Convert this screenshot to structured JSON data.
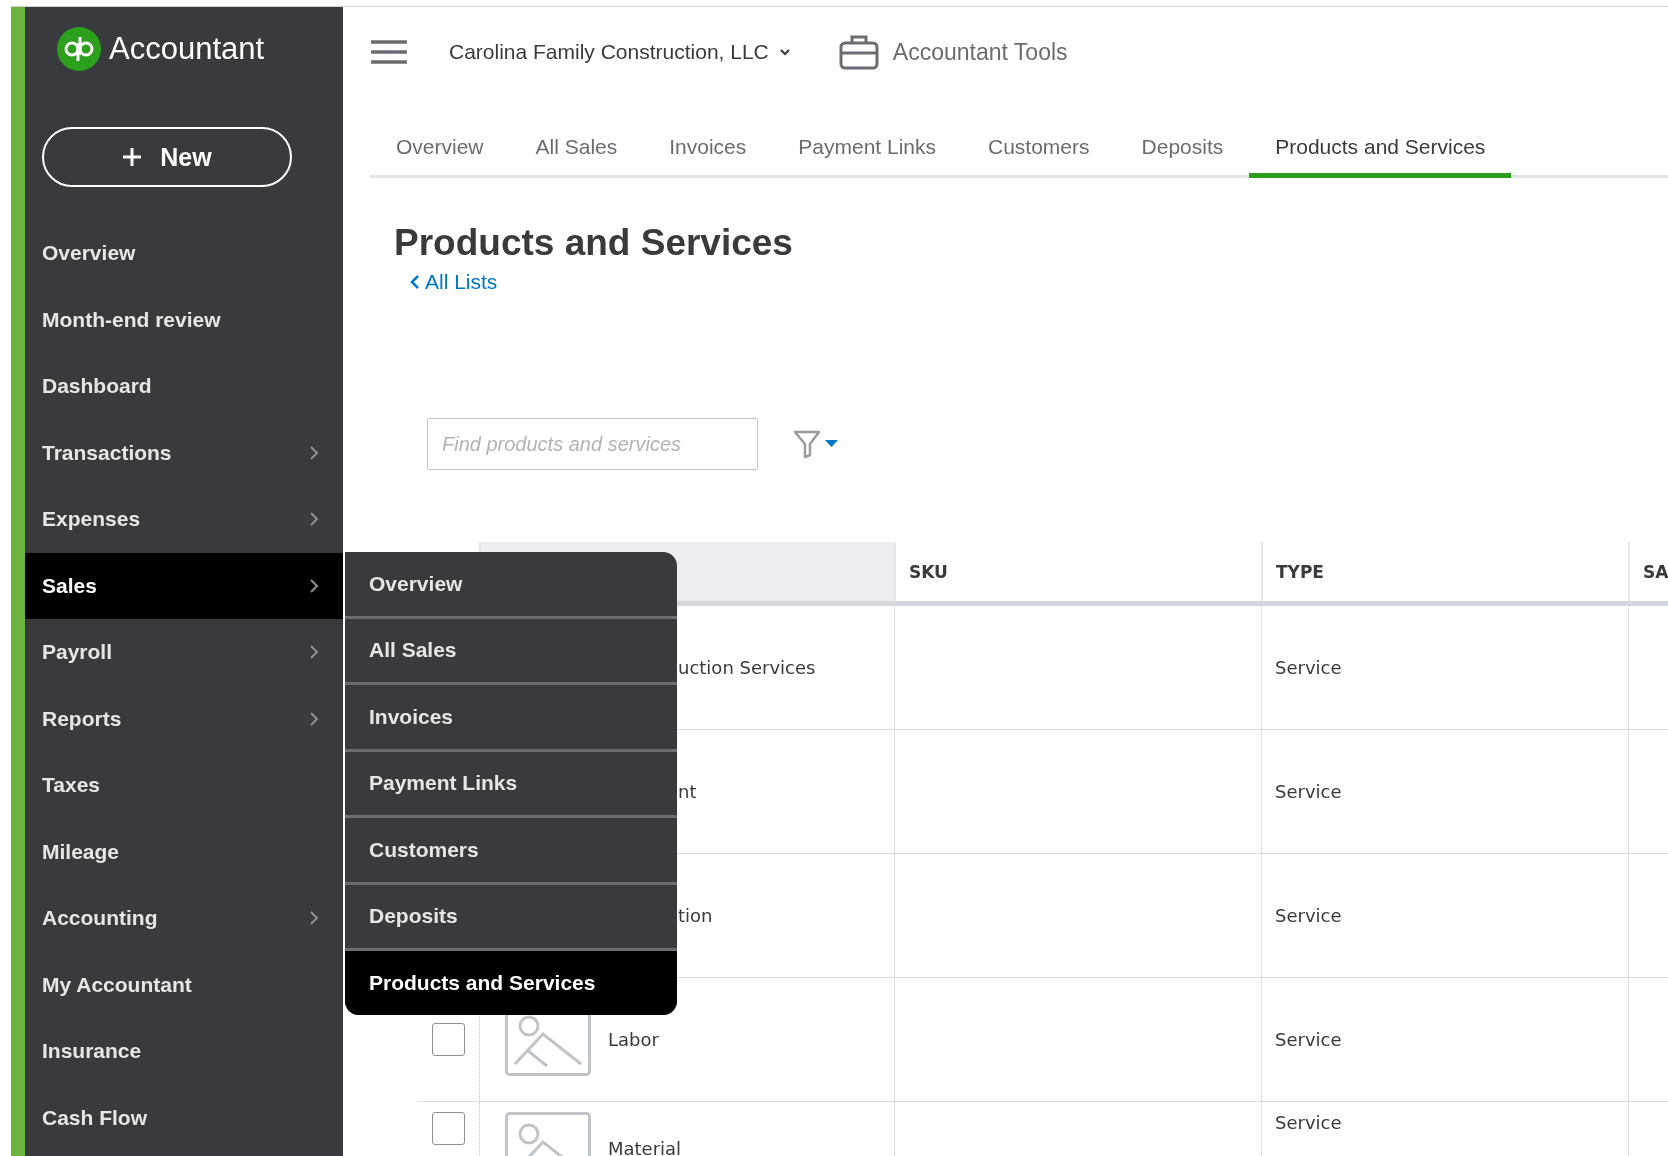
{
  "sidebar": {
    "logo_text": "Accountant",
    "new_button": "New",
    "items": [
      {
        "label": "Overview",
        "has_submenu": false,
        "selected": false
      },
      {
        "label": "Month-end review",
        "has_submenu": false,
        "selected": false
      },
      {
        "label": "Dashboard",
        "has_submenu": false,
        "selected": false
      },
      {
        "label": "Transactions",
        "has_submenu": true,
        "selected": false
      },
      {
        "label": "Expenses",
        "has_submenu": true,
        "selected": false
      },
      {
        "label": "Sales",
        "has_submenu": true,
        "selected": true
      },
      {
        "label": "Payroll",
        "has_submenu": true,
        "selected": false
      },
      {
        "label": "Reports",
        "has_submenu": true,
        "selected": false
      },
      {
        "label": "Taxes",
        "has_submenu": false,
        "selected": false
      },
      {
        "label": "Mileage",
        "has_submenu": false,
        "selected": false
      },
      {
        "label": "Accounting",
        "has_submenu": true,
        "selected": false
      },
      {
        "label": "My Accountant",
        "has_submenu": false,
        "selected": false
      },
      {
        "label": "Insurance",
        "has_submenu": false,
        "selected": false
      },
      {
        "label": "Cash Flow",
        "has_submenu": false,
        "selected": false
      }
    ]
  },
  "submenu": [
    {
      "label": "Overview",
      "selected": false
    },
    {
      "label": "All Sales",
      "selected": false
    },
    {
      "label": "Invoices",
      "selected": false
    },
    {
      "label": "Payment Links",
      "selected": false
    },
    {
      "label": "Customers",
      "selected": false
    },
    {
      "label": "Deposits",
      "selected": false
    },
    {
      "label": "Products and Services",
      "selected": true
    }
  ],
  "topbar": {
    "company": "Carolina Family Construction, LLC",
    "tools": "Accountant Tools"
  },
  "tabs": [
    {
      "label": "Overview",
      "selected": false
    },
    {
      "label": "All Sales",
      "selected": false
    },
    {
      "label": "Invoices",
      "selected": false
    },
    {
      "label": "Payment Links",
      "selected": false
    },
    {
      "label": "Customers",
      "selected": false
    },
    {
      "label": "Deposits",
      "selected": false
    },
    {
      "label": "Products and Services",
      "selected": true
    }
  ],
  "page": {
    "title": "Products and Services",
    "back_link": "All Lists"
  },
  "search": {
    "placeholder": "Find products and services"
  },
  "table": {
    "columns": [
      "SKU",
      "TYPE",
      "SA"
    ],
    "rows": [
      {
        "name": "uction Services",
        "type": "Service"
      },
      {
        "name": "nt",
        "type": "Service"
      },
      {
        "name": "tion",
        "type": "Service"
      },
      {
        "name": "Labor",
        "type": "Service",
        "checked": false,
        "thumbnail": true
      },
      {
        "name": "Material",
        "type": "Service",
        "checked": false,
        "thumbnail": true
      }
    ]
  }
}
